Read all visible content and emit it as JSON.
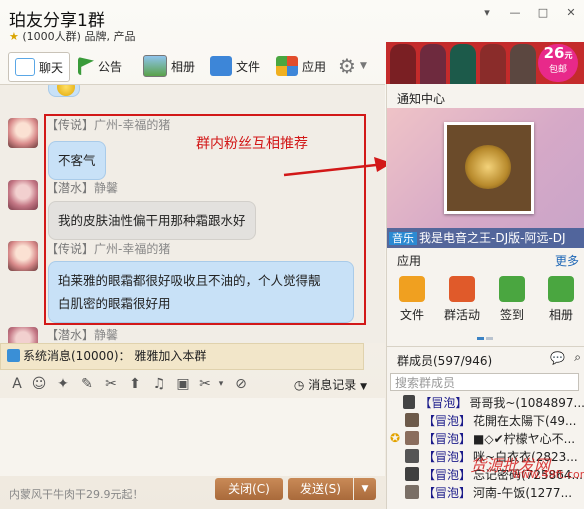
{
  "window": {
    "title": "珀友分享1群",
    "subtitle": "(1000人群) 品牌, 产品",
    "buttons": [
      "▾",
      "—",
      "□",
      "✕"
    ]
  },
  "toolbar": {
    "items": [
      {
        "label": "聊天",
        "icon": "chat-icon",
        "color": "#5aa7e6"
      },
      {
        "label": "公告",
        "icon": "flag-icon",
        "color": "#3a9b3a"
      },
      {
        "label": "相册",
        "icon": "album-icon",
        "color": "#5b9ad4"
      },
      {
        "label": "文件",
        "icon": "folder-icon",
        "color": "#3d86d8"
      },
      {
        "label": "应用",
        "icon": "apps-icon",
        "color": "#e24d2c"
      }
    ]
  },
  "banner": {
    "price": "26",
    "price_unit": "元",
    "price_label": "包邮"
  },
  "chat": {
    "annotation": "群内粉丝互相推荐",
    "messages": [
      {
        "tag": "【传说】",
        "sender": "广州-幸福的猪",
        "text": "不客气",
        "style": "blue"
      },
      {
        "tag": "【潜水】",
        "sender": "静馨",
        "text": "我的皮肤油性偏干用那种霜跟水好",
        "style": "gray"
      },
      {
        "tag": "【传说】",
        "sender": "广州-幸福的猪",
        "text_line1": "珀莱雅的眼霜都很好吸收且不油的，个人觉得靓",
        "text_line2": "白肌密的眼霜很好用",
        "style": "blue"
      },
      {
        "tag": "【潜水】",
        "sender": "静馨"
      }
    ]
  },
  "system_message": "系统消息(10000)： 雅雅加入本群",
  "input_toolbar": {
    "icons": [
      "A",
      "☺",
      "✦",
      "✎",
      "✂",
      "⬆",
      "♫",
      "▣",
      "✂",
      "▾",
      "⊘"
    ],
    "history_label": "消息记录"
  },
  "footer": {
    "ad_text": "内蒙风干牛肉干29.9元起！",
    "close_label": "关闭(C)",
    "send_label": "发送(S)"
  },
  "right_panel": {
    "notice_title": "通知中心",
    "music_tag": "音乐",
    "music_title": "我是电音之王-DJ版-阿远-DJ",
    "apps_title": "应用",
    "apps_more": "更多",
    "apps": [
      {
        "label": "文件",
        "color": "#f0a020"
      },
      {
        "label": "群活动",
        "color": "#e05a2a"
      },
      {
        "label": "签到",
        "color": "#4aa640"
      },
      {
        "label": "相册",
        "color": "#4aa640"
      }
    ],
    "members_title": "群成员(597/946)",
    "search_placeholder": "搜索群成员",
    "members": [
      {
        "tag": "【冒泡】",
        "name": "哥哥我~(1084897..."
      },
      {
        "tag": "【冒泡】",
        "name": "花開在太陽下(49..."
      },
      {
        "tag": "【冒泡】",
        "name": "■◇✔柠檬ヤ心不..."
      },
      {
        "tag": "【冒泡】",
        "name": "咪~白衣衣(2823..."
      },
      {
        "tag": "【冒泡】",
        "name": "忘记密码(725864..."
      },
      {
        "tag": "【冒泡】",
        "name": "河南-午饭(1277..."
      }
    ]
  },
  "watermark": {
    "line1": "货源批发网",
    "line2": "www.49ft.com"
  }
}
